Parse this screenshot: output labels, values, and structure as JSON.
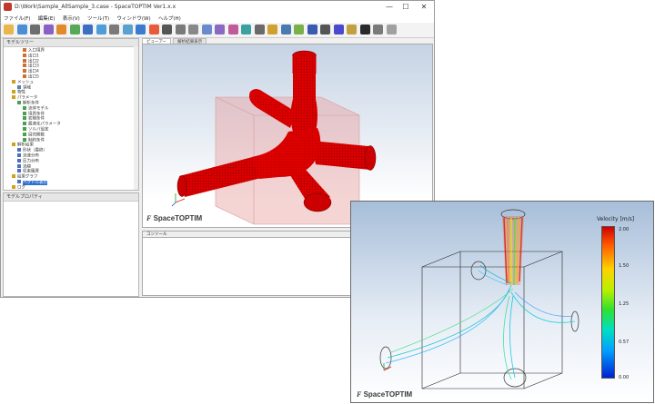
{
  "window": {
    "title": "D:\\Work\\Sample_AllSample_3.case - SpaceTOPTIM Ver1.x.x",
    "minimize": "—",
    "maximize": "☐",
    "close": "✕"
  },
  "menu": [
    "ファイル(F)",
    "編集(E)",
    "表示(V)",
    "ツール(T)",
    "ウィンドウ(W)",
    "ヘルプ(H)"
  ],
  "toolbar_colors": [
    "#e8b64a",
    "#4a8fd6",
    "#6d6d6d",
    "#8c5fc2",
    "#e08a2a",
    "#58a85a",
    "#3b6fc4",
    "#4f9dd8",
    "#7a7a7a",
    "#5aa0d0",
    "#3a7ad0",
    "#e85a3a",
    "#555555",
    "#7a7a7a",
    "#888888",
    "#6a8ad0",
    "#8a6ac0",
    "#c05a9a",
    "#3aa0a0",
    "#6a6a6a",
    "#d0a030",
    "#4a7ab0",
    "#7ab04a",
    "#3a5ab0",
    "#555555",
    "#4a4ad0",
    "#c0a040",
    "#2a2a2a",
    "#7a7a7a",
    "#a0a0a0"
  ],
  "left_panel": {
    "header": "モデルツリー",
    "tree": [
      {
        "label": "入口境界",
        "indent": 3,
        "color": "#d07030"
      },
      {
        "label": "出口1",
        "indent": 3,
        "color": "#d07030"
      },
      {
        "label": "出口2",
        "indent": 3,
        "color": "#d07030"
      },
      {
        "label": "出口3",
        "indent": 3,
        "color": "#d07030"
      },
      {
        "label": "出口4",
        "indent": 3,
        "color": "#d07030"
      },
      {
        "label": "出口5",
        "indent": 3,
        "color": "#d07030"
      },
      {
        "label": "メッシュ",
        "indent": 1,
        "color": "#d0a020"
      },
      {
        "label": "領域",
        "indent": 2,
        "color": "#5080c0"
      },
      {
        "label": "物性",
        "indent": 1,
        "color": "#d0a020"
      },
      {
        "label": "パラメータ",
        "indent": 1,
        "color": "#d0a020"
      },
      {
        "label": "解析条件",
        "indent": 2,
        "color": "#4aa050"
      },
      {
        "label": "流体モデル",
        "indent": 3,
        "color": "#4aa050"
      },
      {
        "label": "境界条件",
        "indent": 3,
        "color": "#4aa050"
      },
      {
        "label": "初期条件",
        "indent": 3,
        "color": "#4aa050"
      },
      {
        "label": "最適化パラメータ",
        "indent": 3,
        "color": "#4aa050"
      },
      {
        "label": "ソルバ設定",
        "indent": 3,
        "color": "#4aa050"
      },
      {
        "label": "目的関数",
        "indent": 3,
        "color": "#4aa050"
      },
      {
        "label": "制約条件",
        "indent": 3,
        "color": "#4aa050"
      },
      {
        "label": "解析結果",
        "indent": 1,
        "color": "#d0a020"
      },
      {
        "label": "形状（最終）",
        "indent": 2,
        "color": "#4a70c0"
      },
      {
        "label": "流速分布",
        "indent": 2,
        "color": "#4a70c0"
      },
      {
        "label": "圧力分布",
        "indent": 2,
        "color": "#4a70c0"
      },
      {
        "label": "流線",
        "indent": 2,
        "color": "#4a70c0"
      },
      {
        "label": "収束履歴",
        "indent": 2,
        "color": "#4a70c0"
      },
      {
        "label": "結果グラフ",
        "indent": 1,
        "color": "#d0a020"
      },
      {
        "label": "ベクトル表示",
        "indent": 2,
        "color": "#4a70c0",
        "selected": true
      },
      {
        "label": "ログ",
        "indent": 1,
        "color": "#d0a020"
      }
    ]
  },
  "left_bottom_header": "モデルプロパティ",
  "tabs": [
    "ビューアー",
    "解析結果表示"
  ],
  "console_header": "コンソール",
  "brand_main": "SpaceTOPTIM",
  "brand_popup": "SpaceTOPTIM",
  "legend": {
    "title": "Velocity    [m/s]",
    "ticks": [
      "2.00",
      "1.50",
      "1.25",
      "0.57",
      "0.00"
    ]
  }
}
